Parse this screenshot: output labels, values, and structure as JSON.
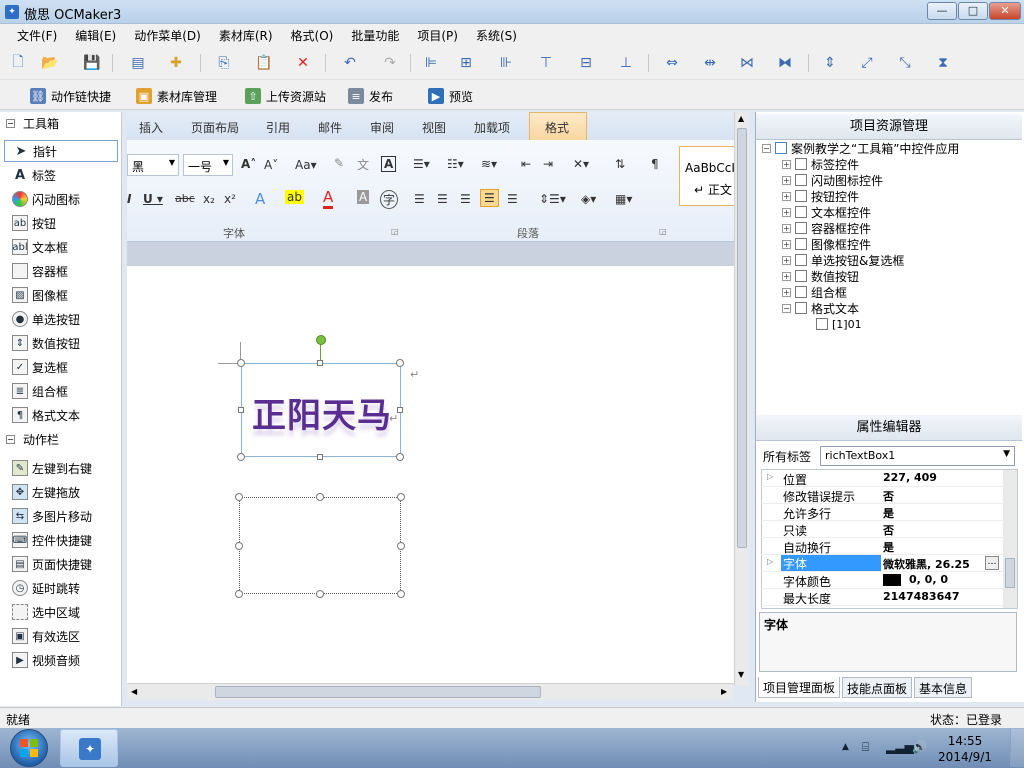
{
  "window": {
    "title": "傲思 OCMaker3",
    "min": "—",
    "max": "□",
    "close": "✕"
  },
  "menu": [
    "文件(F)",
    "编辑(E)",
    "动作菜单(D)",
    "素材库(R)",
    "格式(O)",
    "批量功能",
    "项目(P)",
    "系统(S)"
  ],
  "toolbar2": [
    {
      "label": "动作链快捷",
      "icon": "action-chain-icon"
    },
    {
      "label": "素材库管理",
      "icon": "library-icon"
    },
    {
      "label": "上传资源站",
      "icon": "upload-icon"
    },
    {
      "label": "发布",
      "icon": "publish-icon"
    },
    {
      "label": "预览",
      "icon": "preview-icon"
    }
  ],
  "toolbox": {
    "group1": "工具箱",
    "tools": [
      {
        "label": "指针",
        "icon": "pointer-icon"
      },
      {
        "label": "标签",
        "icon": "label-icon"
      },
      {
        "label": "闪动图标",
        "icon": "flash-icon"
      },
      {
        "label": "按钮",
        "icon": "button-icon"
      },
      {
        "label": "文本框",
        "icon": "textbox-icon"
      },
      {
        "label": "容器框",
        "icon": "container-icon"
      },
      {
        "label": "图像框",
        "icon": "image-icon"
      },
      {
        "label": "单选按钮",
        "icon": "radio-icon"
      },
      {
        "label": "数值按钮",
        "icon": "numeric-icon"
      },
      {
        "label": "复选框",
        "icon": "checkbox-icon"
      },
      {
        "label": "组合框",
        "icon": "combobox-icon"
      },
      {
        "label": "格式文本",
        "icon": "richtext-icon"
      }
    ],
    "group2": "动作栏",
    "actions": [
      {
        "label": "左键到右键",
        "icon": "mouse-icon"
      },
      {
        "label": "左键拖放",
        "icon": "drag-icon"
      },
      {
        "label": "多图片移动",
        "icon": "multi-image-icon"
      },
      {
        "label": "控件快捷键",
        "icon": "control-shortcut-icon"
      },
      {
        "label": "页面快捷键",
        "icon": "page-shortcut-icon"
      },
      {
        "label": "延时跳转",
        "icon": "delay-icon"
      },
      {
        "label": "选中区域",
        "icon": "select-area-icon"
      },
      {
        "label": "有效选区",
        "icon": "valid-area-icon"
      },
      {
        "label": "视频音频",
        "icon": "video-icon"
      }
    ]
  },
  "ribbon": {
    "tabs": [
      "插入",
      "页面布局",
      "引用",
      "邮件",
      "审阅",
      "视图",
      "加载项",
      "格式"
    ],
    "font_name": "黑",
    "font_size": "一号",
    "group_font": "字体",
    "group_paragraph": "段落",
    "style_preview": "AaBbCcI",
    "style_name": "↵ 正文"
  },
  "document": {
    "wordart": "正阳天马",
    "para_mark": "↵"
  },
  "project": {
    "title": "项目资源管理",
    "root": "案例教学之“工具箱”中控件应用",
    "items": [
      "标签控件",
      "闪动图标控件",
      "按钮控件",
      "文本框控件",
      "容器框控件",
      "图像框控件",
      "单选按钮&复选框",
      "数值按钮",
      "组合框",
      "格式文本"
    ],
    "child": "[1]01"
  },
  "properties": {
    "title": "属性编辑器",
    "filter_label": "所有标签",
    "selected": "richTextBox1",
    "rows": [
      {
        "key": "位置",
        "value": "227, 409"
      },
      {
        "key": "修改错误提示",
        "value": "否"
      },
      {
        "key": "允许多行",
        "value": "是"
      },
      {
        "key": "只读",
        "value": "否"
      },
      {
        "key": "自动换行",
        "value": "是"
      },
      {
        "key": "字体",
        "value": "微软雅黑, 26.25"
      },
      {
        "key": "字体颜色",
        "value": "0, 0, 0"
      },
      {
        "key": "最大长度",
        "value": "2147483647"
      }
    ],
    "desc_title": "字体",
    "tabs": [
      "项目管理面板",
      "技能点面板",
      "基本信息"
    ]
  },
  "status": {
    "left": "就绪",
    "right": "状态：已登录"
  },
  "taskbar": {
    "time": "14:55",
    "date": "2014/9/1"
  }
}
